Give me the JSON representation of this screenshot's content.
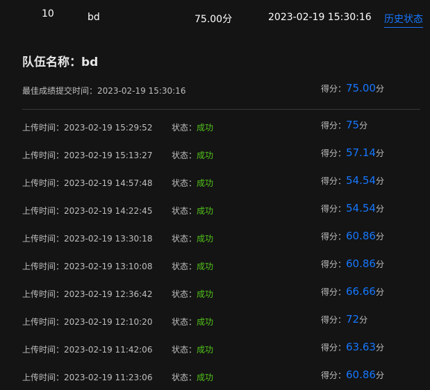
{
  "top_row": {
    "rank": "10",
    "team": "bd",
    "score": "75.00分",
    "time": "2023-02-19 15:30:16",
    "history_link": "历史状态"
  },
  "team_title": "队伍名称：bd",
  "best": {
    "label": "最佳成绩提交时间：2023-02-19 15:30:16",
    "score_label": "得分：",
    "score": "75.00",
    "unit": "分"
  },
  "records": [
    {
      "upload": "上传时间：2023-02-19 15:29:52",
      "status_label": "状态：",
      "status": "成功",
      "score_label": "得分：",
      "score": "75",
      "unit": "分"
    },
    {
      "upload": "上传时间：2023-02-19 15:13:27",
      "status_label": "状态：",
      "status": "成功",
      "score_label": "得分：",
      "score": "57.14",
      "unit": "分"
    },
    {
      "upload": "上传时间：2023-02-19 14:57:48",
      "status_label": "状态：",
      "status": "成功",
      "score_label": "得分：",
      "score": "54.54",
      "unit": "分"
    },
    {
      "upload": "上传时间：2023-02-19 14:22:45",
      "status_label": "状态：",
      "status": "成功",
      "score_label": "得分：",
      "score": "54.54",
      "unit": "分"
    },
    {
      "upload": "上传时间：2023-02-19 13:30:18",
      "status_label": "状态：",
      "status": "成功",
      "score_label": "得分：",
      "score": "60.86",
      "unit": "分"
    },
    {
      "upload": "上传时间：2023-02-19 13:10:08",
      "status_label": "状态：",
      "status": "成功",
      "score_label": "得分：",
      "score": "60.86",
      "unit": "分"
    },
    {
      "upload": "上传时间：2023-02-19 12:36:42",
      "status_label": "状态：",
      "status": "成功",
      "score_label": "得分：",
      "score": "66.66",
      "unit": "分"
    },
    {
      "upload": "上传时间：2023-02-19 12:10:20",
      "status_label": "状态：",
      "status": "成功",
      "score_label": "得分：",
      "score": "72",
      "unit": "分"
    },
    {
      "upload": "上传时间：2023-02-19 11:42:06",
      "status_label": "状态：",
      "status": "成功",
      "score_label": "得分：",
      "score": "63.63",
      "unit": "分"
    },
    {
      "upload": "上传时间：2023-02-19 11:23:06",
      "status_label": "状态：",
      "status": "成功",
      "score_label": "得分：",
      "score": "60.86",
      "unit": "分"
    }
  ],
  "colors": {
    "background": "#141414",
    "accent": "#1677ff",
    "success": "#52c41a"
  }
}
